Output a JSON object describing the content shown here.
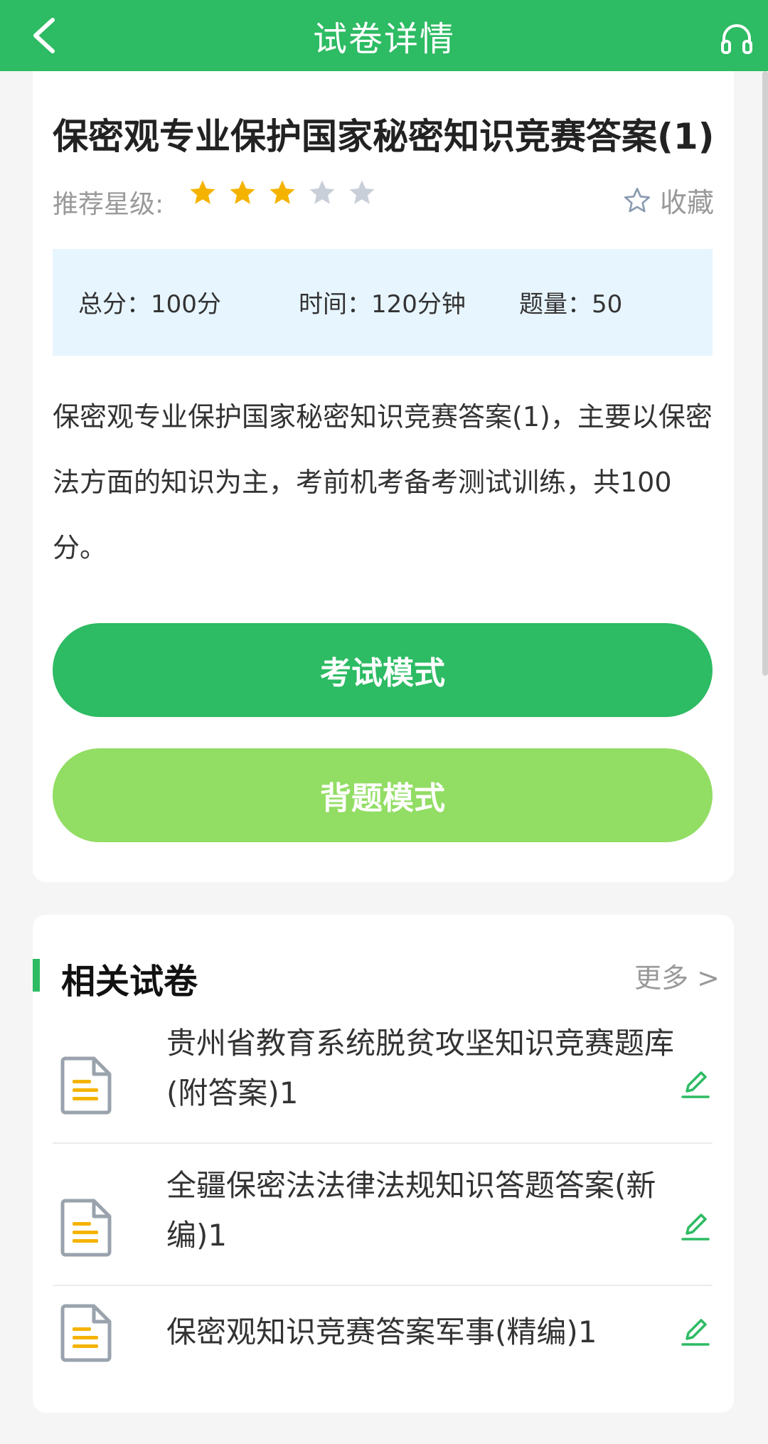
{
  "header": {
    "title": "试卷详情"
  },
  "paper": {
    "title": "保密观专业保护国家秘密知识竞赛答案(1)",
    "rating_label": "推荐星级:",
    "rating": 3,
    "rating_max": 5,
    "favorite_label": "收藏",
    "total_score": "总分：100分",
    "time": "时间：120分钟",
    "question_count": "题量：50",
    "description": "保密观专业保护国家秘密知识竞赛答案(1)，主要以保密法方面的知识为主，考前机考备考测试训练，共100分。"
  },
  "buttons": {
    "exam_mode": "考试模式",
    "study_mode": "背题模式"
  },
  "related": {
    "title": "相关试卷",
    "more": "更多 >",
    "items": [
      {
        "name": "贵州省教育系统脱贫攻坚知识竞赛题库(附答案)1"
      },
      {
        "name": "全疆保密法法律法规知识答题答案(新编)1"
      },
      {
        "name": "保密观知识竞赛答案军事(精编)1"
      }
    ]
  },
  "colors": {
    "primary": "#2dbb63",
    "secondary_button": "#92dd63",
    "star_active": "#f5b301",
    "star_inactive": "#c9cfd8",
    "info_bg": "#e7f5ff",
    "doc_icon_accent": "#f5b301"
  },
  "icons": {
    "back": "chevron-left-icon",
    "headset": "headset-icon",
    "star": "star-icon",
    "favorite": "star-outline-icon",
    "document": "document-icon",
    "edit": "pencil-icon"
  }
}
